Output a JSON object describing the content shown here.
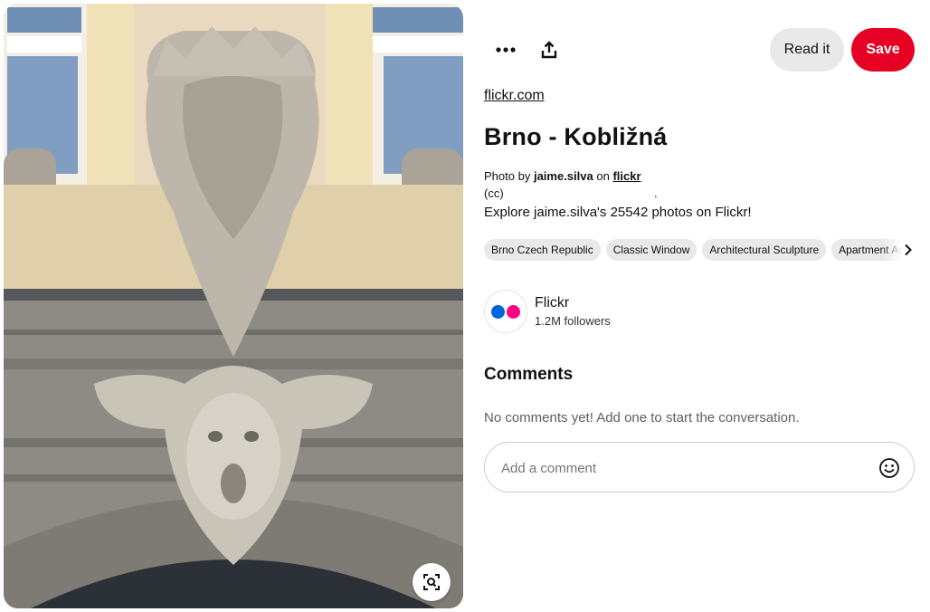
{
  "pin": {
    "source_domain": "flickr.com",
    "title": "Brno - Kobližná",
    "credit_prefix": "Photo by",
    "credit_author": "jaime.silva",
    "credit_mid": "on",
    "credit_site": "flickr",
    "license": "(cc)",
    "license_trailing": ".",
    "description": "Explore jaime.silva's 25542 photos on Flickr!"
  },
  "actions": {
    "more_icon": "ellipsis-icon",
    "share_icon": "share-icon",
    "read_label": "Read it",
    "save_label": "Save"
  },
  "tags": [
    "Brno Czech Republic",
    "Classic Window",
    "Architectural Sculpture",
    "Apartment Architecture"
  ],
  "creator": {
    "name": "Flickr",
    "followers": "1.2M followers",
    "logo_colors": [
      "#0063dc",
      "#ff0084"
    ]
  },
  "comments": {
    "heading": "Comments",
    "empty_text": "No comments yet! Add one to start the conversation.",
    "placeholder": "Add a comment",
    "emoji_icon": "smiley-icon"
  },
  "colors": {
    "save": "#e60023",
    "read": "#e9e9e9"
  }
}
